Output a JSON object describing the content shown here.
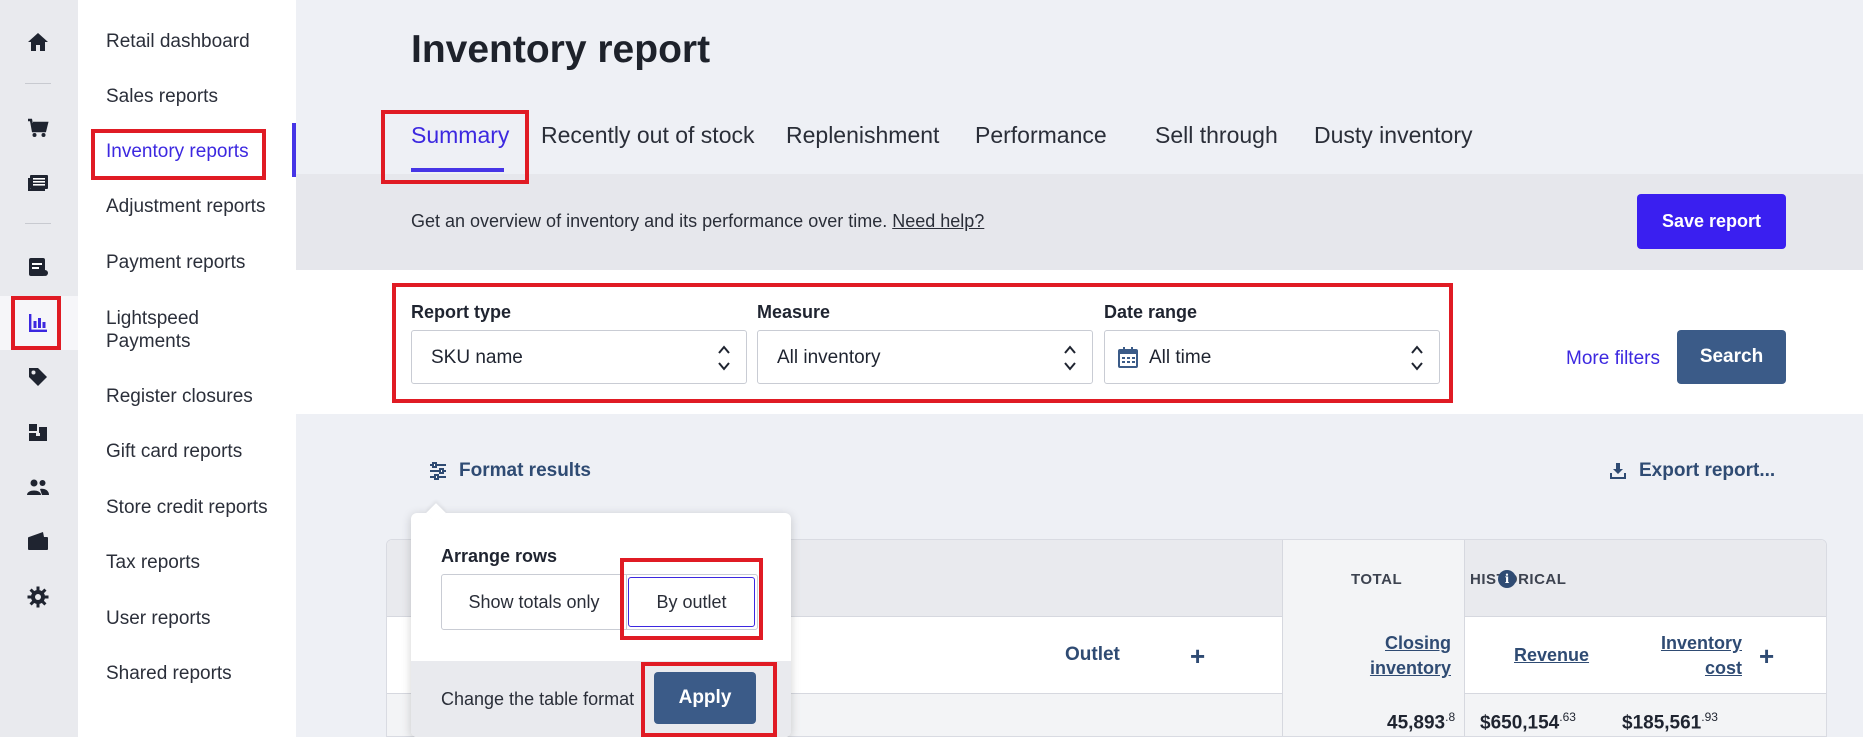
{
  "sidebar": {
    "items": [
      {
        "label": "Retail dashboard"
      },
      {
        "label": "Sales reports"
      },
      {
        "label": "Inventory reports"
      },
      {
        "label": "Adjustment reports"
      },
      {
        "label": "Payment reports"
      },
      {
        "label": "Lightspeed Payments"
      },
      {
        "label": "Register closures"
      },
      {
        "label": "Gift card reports"
      },
      {
        "label": "Store credit reports"
      },
      {
        "label": "Tax reports"
      },
      {
        "label": "User reports"
      },
      {
        "label": "Shared reports"
      }
    ],
    "active_item": "Inventory reports"
  },
  "rail_icons": [
    "home-icon",
    "cart-icon",
    "catalog-icon",
    "invoice-icon",
    "reports-icon",
    "tag-icon",
    "boxes-icon",
    "customers-icon",
    "wallet-icon",
    "settings-icon"
  ],
  "page": {
    "title": "Inventory report"
  },
  "tabs": [
    {
      "label": "Summary",
      "active": true
    },
    {
      "label": "Recently out of stock"
    },
    {
      "label": "Replenishment"
    },
    {
      "label": "Performance"
    },
    {
      "label": "Sell through"
    },
    {
      "label": "Dusty inventory"
    }
  ],
  "banner": {
    "text": "Get an overview of inventory and its performance over time.",
    "help_link": "Need help?",
    "save_label": "Save report"
  },
  "filters": {
    "report_type_label": "Report type",
    "report_type_value": "SKU name",
    "measure_label": "Measure",
    "measure_value": "All inventory",
    "date_range_label": "Date range",
    "date_range_value": "All time",
    "more_filters": "More filters",
    "search_label": "Search"
  },
  "actions": {
    "format_results": "Format results",
    "export_report": "Export report..."
  },
  "popover": {
    "title": "Arrange rows",
    "option_totals": "Show totals only",
    "option_outlet": "By outlet",
    "selected": "By outlet",
    "footer_text": "Change the table format",
    "apply_label": "Apply"
  },
  "table": {
    "group_total": "TOTAL",
    "group_historical": "HISTORICAL",
    "col_outlet": "Outlet",
    "col_closing_1": "Closing",
    "col_closing_2": "inventory",
    "col_revenue": "Revenue",
    "col_cost_1": "Inventory",
    "col_cost_2": "cost",
    "row": {
      "closing_main": "45,893",
      "closing_dec": ".8",
      "revenue_main": "$650,154",
      "revenue_dec": ".63",
      "cost_main": "$185,561",
      "cost_dec": ".93"
    }
  },
  "colors": {
    "accent": "#3c28e0",
    "primary_button": "#3a1ff0",
    "secondary_button": "#3b5b88",
    "highlight": "#e01b24"
  }
}
